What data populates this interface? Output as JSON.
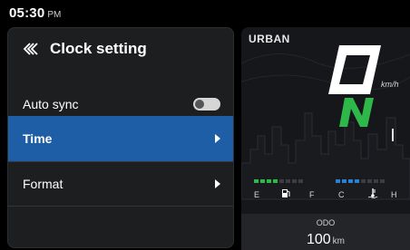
{
  "status": {
    "time": "05:30",
    "ampm": "PM"
  },
  "menu": {
    "title": "Clock setting",
    "items": [
      {
        "label": "Auto sync",
        "control": "toggle",
        "toggle_on": false
      },
      {
        "label": "Time",
        "control": "chevron",
        "selected": true
      },
      {
        "label": "Format",
        "control": "chevron"
      }
    ],
    "selected_color": "#1e5ea6"
  },
  "dash": {
    "mode": "URBAN",
    "speed_glyph": "0",
    "speed_unit": "km/h",
    "gear": "N",
    "gear_color": "#2fb84a",
    "fuel": {
      "empty_label": "E",
      "full_label": "F",
      "segments_total": 8,
      "segments_filled": 4,
      "color": "#2fb84a"
    },
    "temp": {
      "cold_label": "C",
      "hot_label": "H",
      "segments_total": 8,
      "segments_filled": 4,
      "color": "#2a7fd6"
    },
    "odo_label": "ODO",
    "odo_value": "100",
    "odo_unit": "km"
  }
}
